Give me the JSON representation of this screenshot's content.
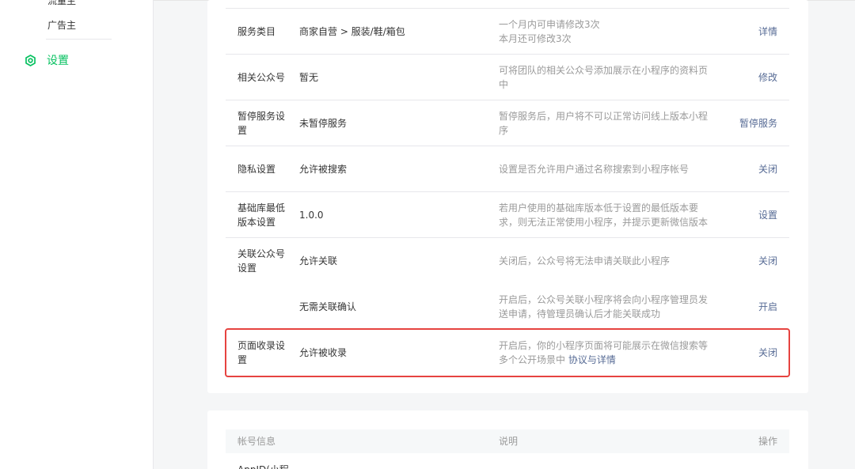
{
  "sidebar": {
    "cut_item": "流量主",
    "ad_item": "广告主",
    "settings_label": "设置"
  },
  "colors": {
    "accent_green": "#07c160",
    "link_blue": "#576b95",
    "highlight_red": "#e64340"
  },
  "settings_rows": [
    {
      "label": "服务类目",
      "value": "商家自营 > 服装/鞋/箱包",
      "desc": "一个月内可申请修改3次",
      "desc2": "本月还可修改3次",
      "action": "详情"
    },
    {
      "label": "相关公众号",
      "value": "暂无",
      "desc": "可将团队的相关公众号添加展示在小程序的资料页中",
      "action": "修改"
    },
    {
      "label": "暂停服务设置",
      "value": "未暂停服务",
      "desc": "暂停服务后，用户将不可以正常访问线上版本小程序",
      "action": "暂停服务"
    },
    {
      "label": "隐私设置",
      "value": "允许被搜索",
      "desc": "设置是否允许用户通过名称搜索到小程序帐号",
      "action": "关闭"
    },
    {
      "label": "基础库最低版本设置",
      "value": "1.0.0",
      "desc": "若用户使用的基础库版本低于设置的最低版本要求，则无法正常使用小程序，并提示更新微信版本",
      "action": "设置"
    },
    {
      "label": "关联公众号设置",
      "value": "允许关联",
      "desc": "关闭后，公众号将无法申请关联此小程序",
      "action": "关闭"
    },
    {
      "label": "",
      "value": "无需关联确认",
      "desc": "开启后，公众号关联小程序将会向小程序管理员发送申请，待管理员确认后才能关联成功",
      "action": "开启"
    },
    {
      "label": "页面收录设置",
      "value": "允许被收录",
      "desc": "开启后，你的小程序页面将可能展示在微信搜索等多个公开场景中",
      "desc_link": "协议与详情",
      "action": "关闭"
    }
  ],
  "account_table": {
    "col_info": "帐号信息",
    "col_desc": "说明",
    "col_action": "操作",
    "first_row_label": "AppID(小程"
  }
}
